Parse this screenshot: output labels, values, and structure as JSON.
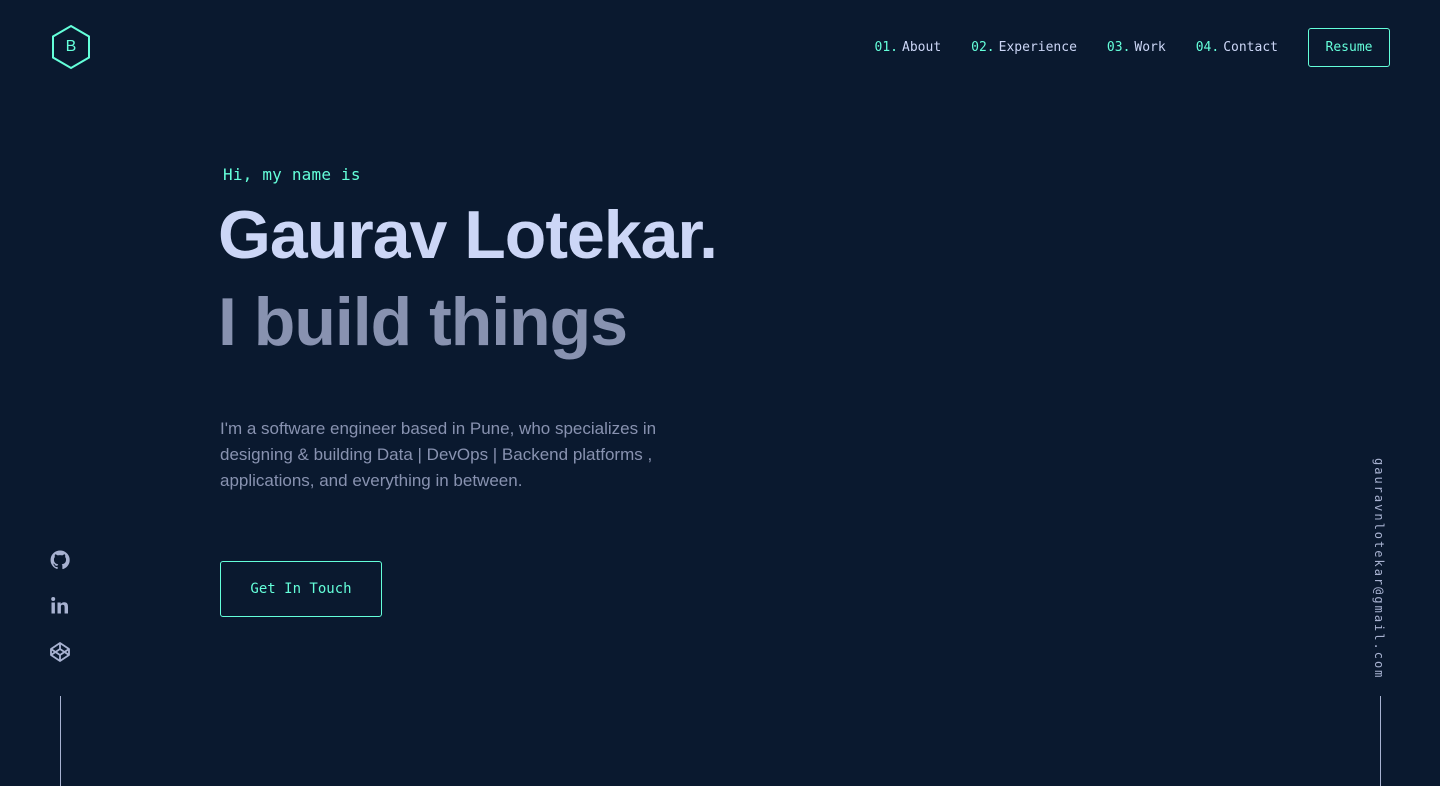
{
  "header": {
    "logo_letter": "B",
    "nav": [
      {
        "num": "01.",
        "label": "About"
      },
      {
        "num": "02.",
        "label": "Experience"
      },
      {
        "num": "03.",
        "label": "Work"
      },
      {
        "num": "04.",
        "label": "Contact"
      }
    ],
    "resume_label": "Resume"
  },
  "hero": {
    "greeting": "Hi, my name is",
    "name": "Gaurav Lotekar.",
    "tagline": "I build things",
    "bio": "I'm a software engineer based in Pune, who specializes in designing & building Data | DevOps | Backend platforms , applications, and everything in between.",
    "cta_label": "Get In Touch"
  },
  "social": {
    "icons": [
      "github-icon",
      "linkedin-icon",
      "codepen-icon"
    ]
  },
  "email": "gauravnlotekar@gmail.com",
  "colors": {
    "background": "#0a192f",
    "accent": "#64ffda",
    "heading": "#ccd6f6",
    "body_text": "#8892b0"
  }
}
